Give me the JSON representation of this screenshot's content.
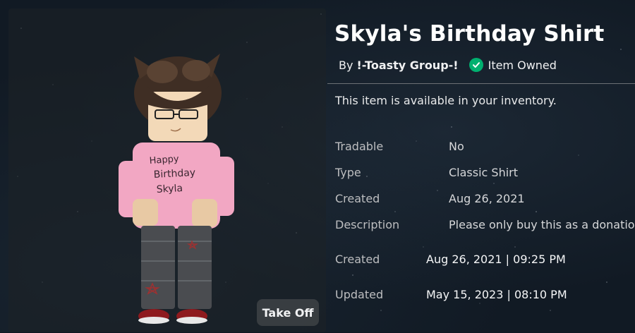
{
  "item": {
    "title": "Skyla's Birthday Shirt",
    "by_prefix": "By",
    "creator": "!-Toasty Group-!",
    "owned_label": "Item Owned",
    "availability": "This item is available in your inventory."
  },
  "details": [
    {
      "label": "Tradable",
      "value": "No"
    },
    {
      "label": "Type",
      "value": "Classic Shirt"
    },
    {
      "label": "Created",
      "value": "Aug 26, 2021"
    },
    {
      "label": "Description",
      "value": "Please only buy this as a donation"
    }
  ],
  "timestamps": [
    {
      "label": "Created",
      "value": "Aug 26, 2021 | 09:25 PM"
    },
    {
      "label": "Updated",
      "value": "May 15, 2023 | 08:10 PM"
    }
  ],
  "avatar": {
    "shirt_text": [
      "Happy",
      "Birthday",
      "Skyla"
    ]
  },
  "buttons": {
    "take_off": "Take Off"
  },
  "colors": {
    "owned_check": "#00b06f",
    "shirt": "#f2a7c3",
    "background": "#111a24"
  },
  "icons": [
    "check-circle-icon"
  ]
}
